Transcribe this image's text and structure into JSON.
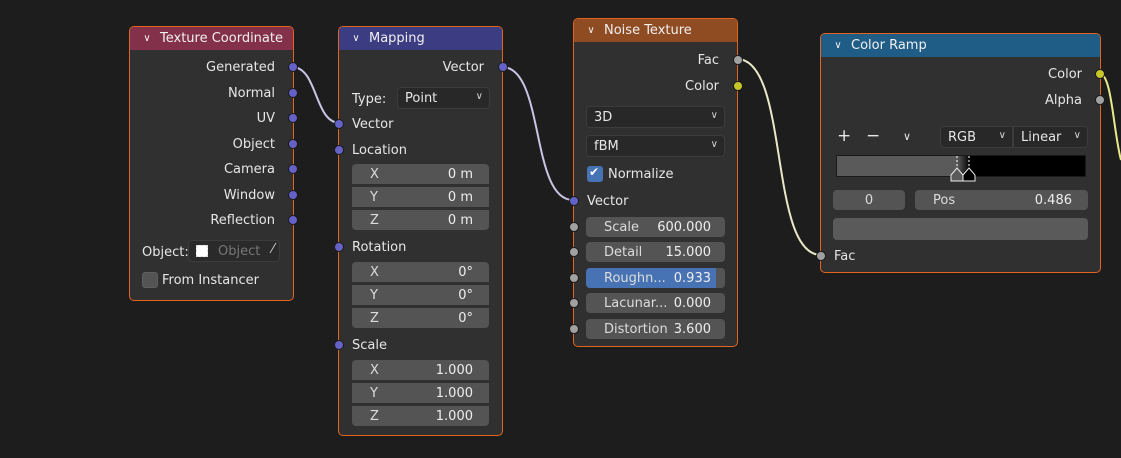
{
  "colors": {
    "vector_socket": "#6462c7",
    "grey_socket": "#a1a1a1",
    "color_socket": "#c7c729",
    "node_border_selected": "#e2651d",
    "texture_coordinate_header": "#83314a",
    "mapping_header": "#3c3c83",
    "noise_texture_header": "#8f4b21",
    "color_ramp_header": "#1f5d87",
    "slider_active": "#4772b3"
  },
  "texture_coordinate": {
    "title": "Texture Coordinate",
    "outputs": [
      "Generated",
      "Normal",
      "UV",
      "Object",
      "Camera",
      "Window",
      "Reflection"
    ],
    "object_label": "Object:",
    "object_placeholder": "Object",
    "from_instancer": "From Instancer"
  },
  "mapping": {
    "title": "Mapping",
    "output": "Vector",
    "type_label": "Type:",
    "type_value": "Point",
    "vector_input": "Vector",
    "location_label": "Location",
    "location": [
      {
        "k": "X",
        "v": "0 m"
      },
      {
        "k": "Y",
        "v": "0 m"
      },
      {
        "k": "Z",
        "v": "0 m"
      }
    ],
    "rotation_label": "Rotation",
    "rotation": [
      {
        "k": "X",
        "v": "0°"
      },
      {
        "k": "Y",
        "v": "0°"
      },
      {
        "k": "Z",
        "v": "0°"
      }
    ],
    "scale_label": "Scale",
    "scale": [
      {
        "k": "X",
        "v": "1.000"
      },
      {
        "k": "Y",
        "v": "1.000"
      },
      {
        "k": "Z",
        "v": "1.000"
      }
    ]
  },
  "noise_texture": {
    "title": "Noise Texture",
    "outputs": [
      "Fac",
      "Color"
    ],
    "dimensions": "3D",
    "noise_type": "fBM",
    "normalize": "Normalize",
    "vector_input": "Vector",
    "fields": [
      {
        "k": "Scale",
        "v": "600.000"
      },
      {
        "k": "Detail",
        "v": "15.000"
      },
      {
        "k": "Roughn...",
        "v": "0.933",
        "fraction": 0.933
      },
      {
        "k": "Lacunar...",
        "v": "0.000"
      },
      {
        "k": "Distortion",
        "v": "3.600"
      }
    ]
  },
  "color_ramp": {
    "title": "Color Ramp",
    "outputs": [
      "Color",
      "Alpha"
    ],
    "add": "+",
    "remove": "−",
    "menu": "∨",
    "color_mode": "RGB",
    "interpolation": "Linear",
    "stop_index": "0",
    "pos_label": "Pos",
    "pos_value": "0.486",
    "input": "Fac"
  }
}
